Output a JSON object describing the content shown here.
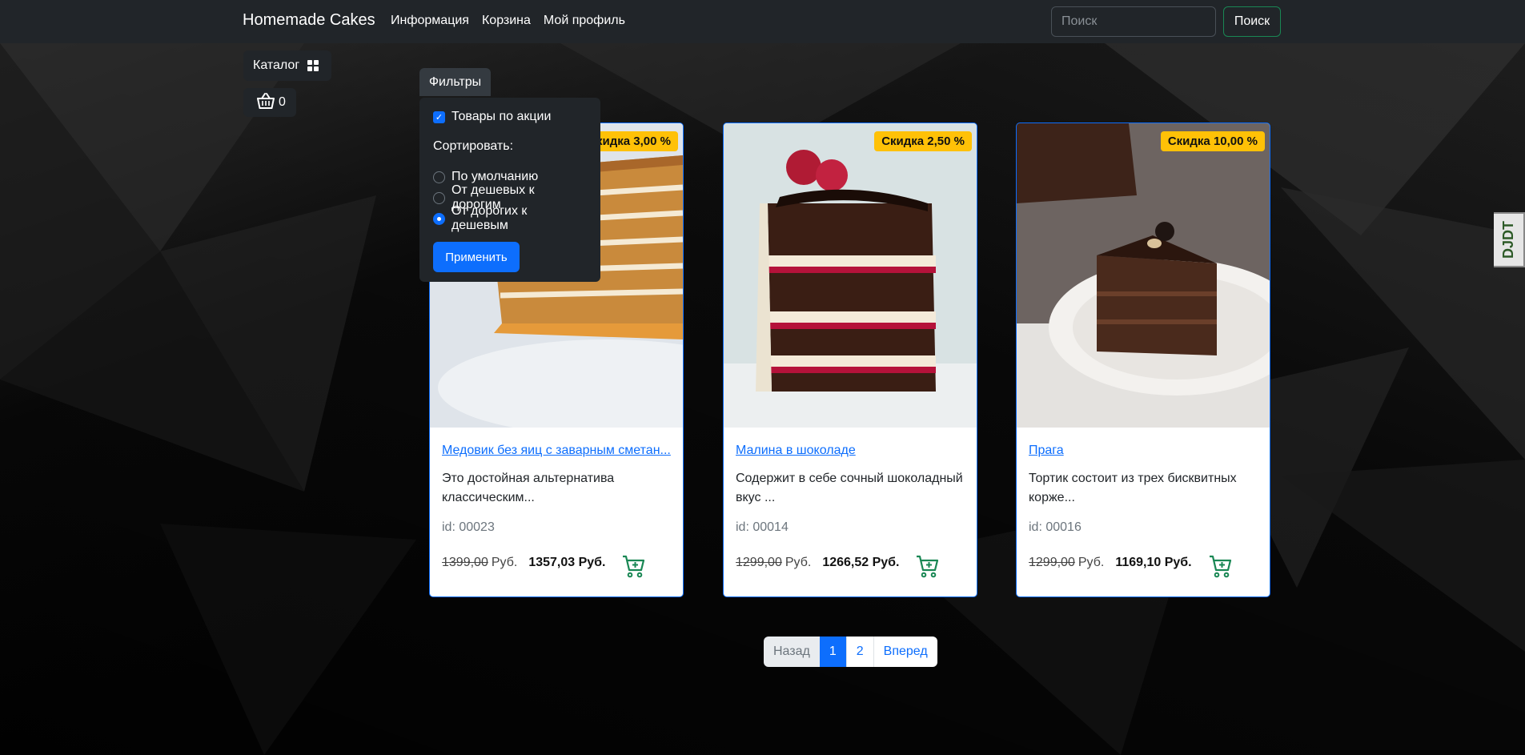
{
  "navbar": {
    "brand": "Homemade Cakes",
    "links": [
      "Информация",
      "Корзина",
      "Мой профиль"
    ],
    "search_placeholder": "Поиск",
    "search_button": "Поиск"
  },
  "sidebar": {
    "catalog_label": "Каталог",
    "cart_count": "0"
  },
  "filters": {
    "button_label": "Фильтры",
    "promo_checkbox_label": "Товары по акции",
    "promo_checked": true,
    "sort_label": "Сортировать:",
    "sort_options": [
      "По умолчанию",
      "От дешевых к дорогим",
      "От дорогих к дешевым"
    ],
    "sort_selected": 2,
    "apply_label": "Применить"
  },
  "products": [
    {
      "badge": "Скидка 3,00 %",
      "title": "Медовик без яиц с заварным сметан...",
      "description": "Это достойная альтернатива классическим...",
      "id_label": "id: 00023",
      "old_price": "1399,00",
      "currency": "Руб.",
      "new_price": "1357,03 Руб."
    },
    {
      "badge": "Скидка 2,50 %",
      "title": "Малина в шоколаде",
      "description": "Содержит в себе сочный шоколадный вкус ...",
      "id_label": "id: 00014",
      "old_price": "1299,00",
      "currency": "Руб.",
      "new_price": "1266,52 Руб."
    },
    {
      "badge": "Скидка 10,00 %",
      "title": "Прага",
      "description": "Тортик состоит из трех бисквитных корже...",
      "id_label": "id: 00016",
      "old_price": "1299,00",
      "currency": "Руб.",
      "new_price": "1169,10 Руб."
    }
  ],
  "pagination": {
    "prev": "Назад",
    "pages": [
      "1",
      "2"
    ],
    "active": "1",
    "next": "Вперед"
  },
  "extension_tab": "DJDT",
  "colors": {
    "primary": "#0d6efd",
    "badge": "#ffc107",
    "navbar": "#212529",
    "cart_icon": "#198754"
  }
}
